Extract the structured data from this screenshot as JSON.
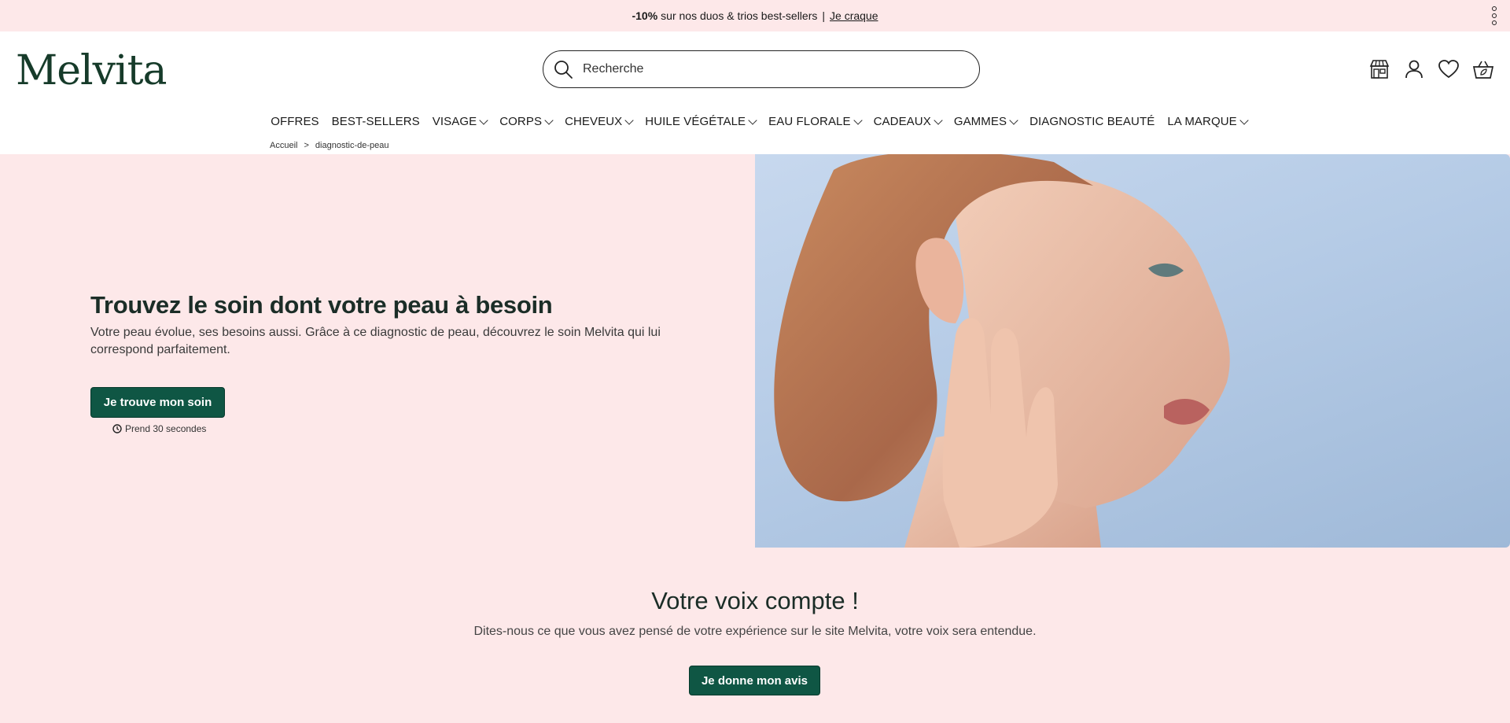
{
  "promo": {
    "highlight": "-10%",
    "text": "sur nos duos & trios best-sellers",
    "separator": "|",
    "link": "Je craque",
    "menu_icon": "more-vertical-icon"
  },
  "header": {
    "logo": "Melvita",
    "search_placeholder": "Recherche",
    "icons": [
      "store-icon",
      "user-icon",
      "heart-icon",
      "basket-icon"
    ]
  },
  "nav": {
    "items": [
      {
        "label": "OFFRES"
      },
      {
        "label": "BEST-SELLERS"
      },
      {
        "label": "VISAGE"
      },
      {
        "label": "CORPS"
      },
      {
        "label": "CHEVEUX"
      },
      {
        "label": "HUILE VÉGÉTALE"
      },
      {
        "label": "EAU FLORALE"
      },
      {
        "label": "CADEAUX"
      },
      {
        "label": "GAMMES"
      },
      {
        "label": "DIAGNOSTIC BEAUTÉ"
      },
      {
        "label": "LA MARQUE"
      }
    ]
  },
  "breadcrumb": {
    "home": "Accueil",
    "separator": ">",
    "current": "diagnostic-de-peau"
  },
  "hero": {
    "title": "Trouvez le soin dont votre peau à besoin",
    "description": "Votre peau évolue, ses besoins aussi. Grâce à ce diagnostic de peau, découvrez le soin Melvita qui lui correspond parfaitement.",
    "button": "Je trouve mon soin",
    "time_note": "Prend 30 secondes"
  },
  "feedback": {
    "title": "Votre voix compte !",
    "description": "Dites-nous ce que vous avez pensé de votre expérience sur le site Melvita, votre voix sera entendue.",
    "button": "Je donne mon avis"
  },
  "colors": {
    "pink_bg": "#fde8e9",
    "brand_green": "#0f5644",
    "logo_green": "#163b2a",
    "sky_blue": "#b5cbe6"
  }
}
